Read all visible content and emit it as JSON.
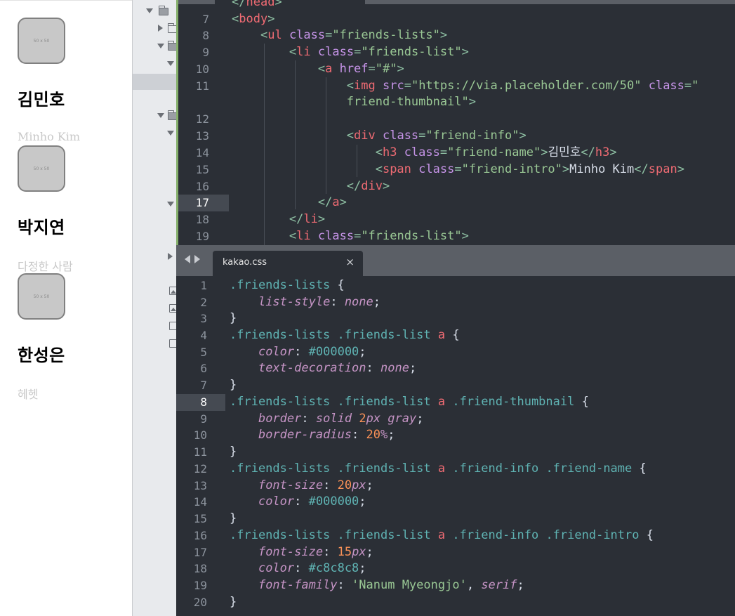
{
  "preview": {
    "friends": [
      {
        "thumb_label": "50 x 50",
        "name": "김민호",
        "intro": "Minho Kim"
      },
      {
        "thumb_label": "50 x 50",
        "name": "박지연",
        "intro": "다정한 사람"
      },
      {
        "thumb_label": "50 x 50",
        "name": "한성은",
        "intro": "헤헷"
      }
    ]
  },
  "html_editor": {
    "line_numbers": [
      "7",
      "8",
      "9",
      "10",
      "11",
      "",
      "12",
      "13",
      "14",
      "15",
      "16",
      "17",
      "18",
      "19"
    ],
    "active_line": "17"
  },
  "css_editor": {
    "tab_label": "kakao.css",
    "close_glyph": "×",
    "line_numbers": [
      "1",
      "2",
      "3",
      "4",
      "5",
      "6",
      "7",
      "8",
      "9",
      "10",
      "11",
      "12",
      "13",
      "14",
      "15",
      "16",
      "17",
      "18",
      "19",
      "20"
    ],
    "active_line": "8"
  },
  "icons": {
    "fold_open": "triangle-down",
    "fold_closed": "triangle-right",
    "nav_back": "triangle-left",
    "nav_forward": "triangle-right"
  },
  "colors": {
    "editor_bg": "#2b2f36",
    "tab_bar": "#5b5f66",
    "modified_marker": "#85b06b",
    "intro_text": "#c8c8c8"
  }
}
